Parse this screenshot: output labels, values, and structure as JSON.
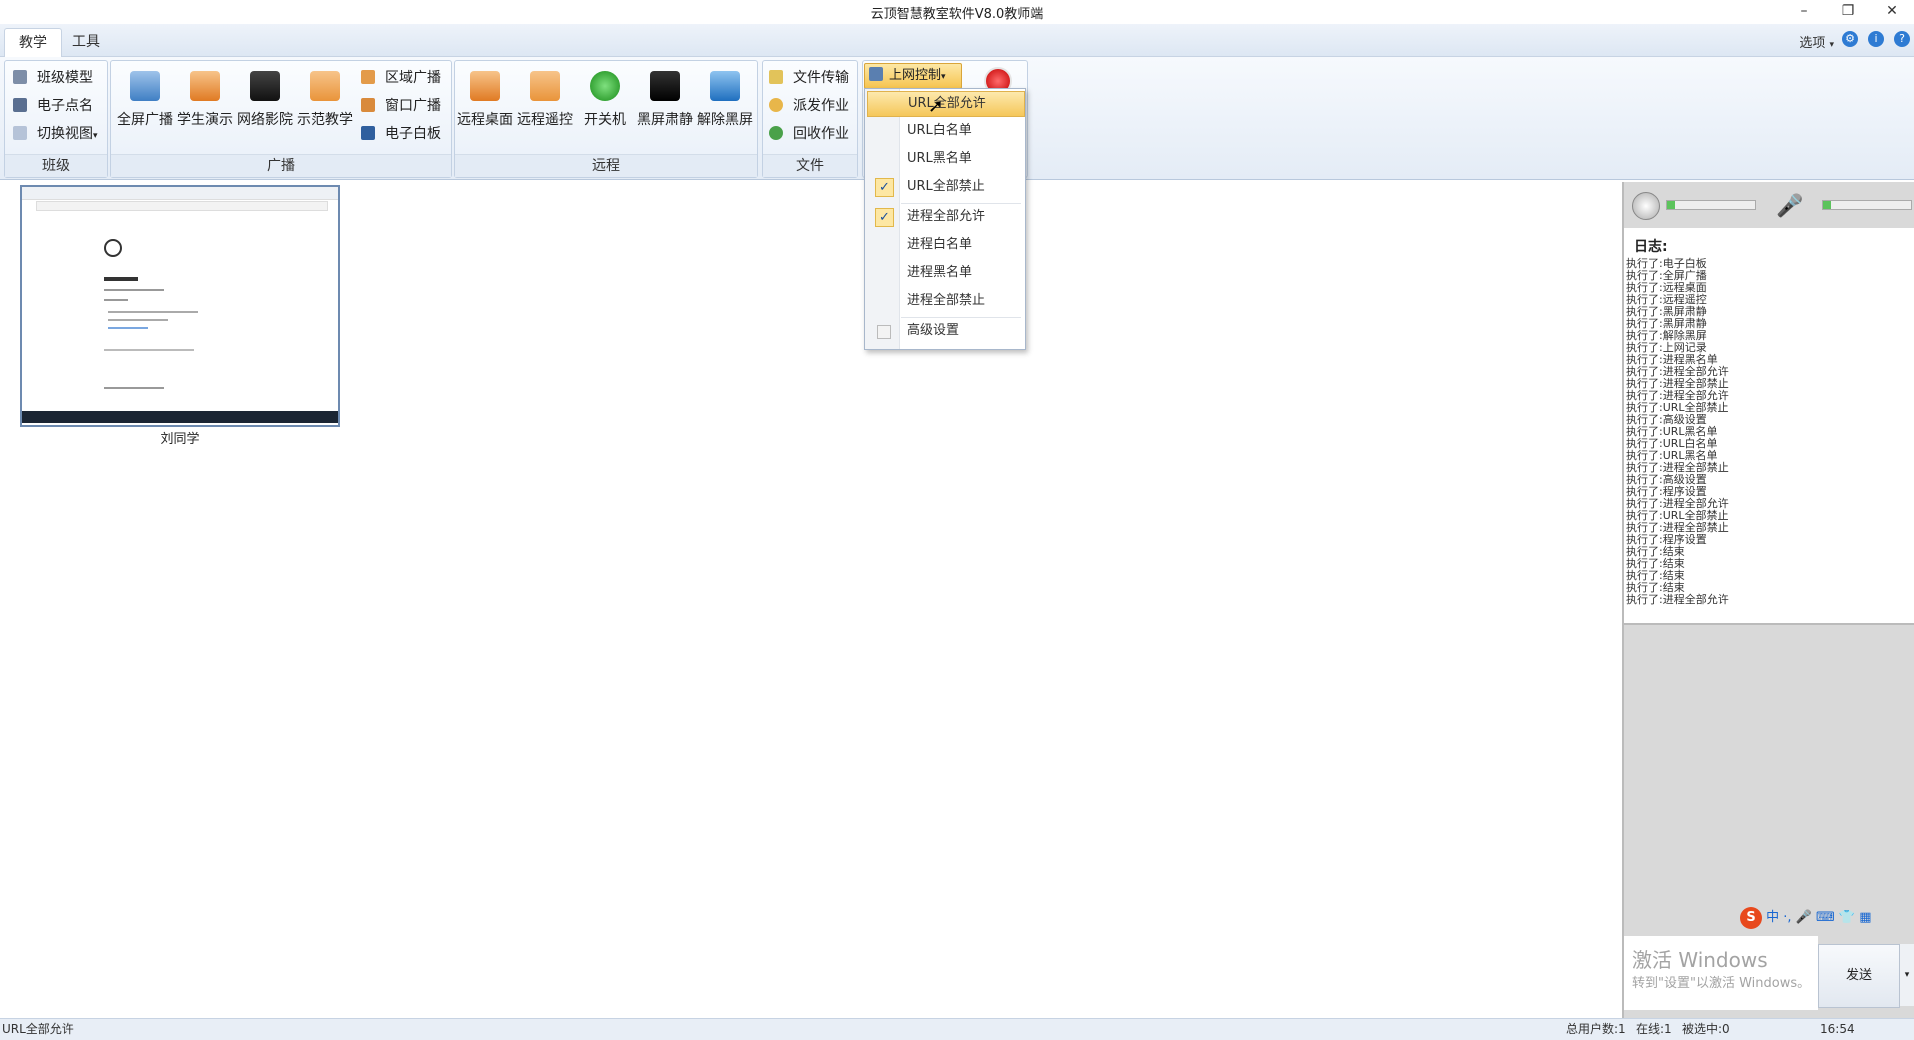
{
  "window": {
    "title": "云顶智慧教室软件V8.0教师端",
    "minimize": "–",
    "restore": "❐",
    "close": "✕"
  },
  "tabs": [
    {
      "label": "教学"
    },
    {
      "label": "工具"
    }
  ],
  "top_right": {
    "options_label": "选项"
  },
  "ribbon": {
    "class_group": {
      "caption": "班级",
      "items": [
        {
          "label": "班级模型"
        },
        {
          "label": "电子点名"
        },
        {
          "label": "切换视图"
        }
      ]
    },
    "broadcast_group": {
      "caption": "广播",
      "big_buttons": [
        {
          "label": "全屏广播"
        },
        {
          "label": "学生演示"
        },
        {
          "label": "网络影院"
        },
        {
          "label": "示范教学"
        }
      ],
      "small_items": [
        {
          "label": "区域广播"
        },
        {
          "label": "窗口广播"
        },
        {
          "label": "电子白板"
        }
      ]
    },
    "remote_group": {
      "caption": "远程",
      "big_buttons": [
        {
          "label": "远程桌面"
        },
        {
          "label": "远程遥控"
        },
        {
          "label": "开关机"
        },
        {
          "label": "黑屏肃静"
        },
        {
          "label": "解除黑屏"
        }
      ]
    },
    "file_group": {
      "caption": "文件",
      "items": [
        {
          "label": "文件传输"
        },
        {
          "label": "派发作业"
        },
        {
          "label": "回收作业"
        }
      ]
    },
    "network_control": {
      "label": "上网控制"
    }
  },
  "dropdown": {
    "items": [
      {
        "label": "URL全部允许",
        "checked": false,
        "highlighted": true
      },
      {
        "label": "URL白名单",
        "checked": false
      },
      {
        "label": "URL黑名单",
        "checked": false
      },
      {
        "label": "URL全部禁止",
        "checked": true
      },
      {
        "label": "进程全部允许",
        "checked": true
      },
      {
        "label": "进程白名单",
        "checked": false
      },
      {
        "label": "进程黑名单",
        "checked": false
      },
      {
        "label": "进程全部禁止",
        "checked": false
      },
      {
        "label": "高级设置",
        "checked": false
      }
    ]
  },
  "students": [
    {
      "name": "刘同学"
    }
  ],
  "log": {
    "title": "日志:",
    "lines": [
      "执行了:电子白板",
      "执行了:全屏广播",
      "执行了:远程桌面",
      "执行了:远程遥控",
      "执行了:黑屏肃静",
      "执行了:黑屏肃静",
      "执行了:解除黑屏",
      "执行了:上网记录",
      "执行了:进程黑名单",
      "执行了:进程全部允许",
      "执行了:进程全部禁止",
      "执行了:进程全部允许",
      "执行了:URL全部禁止",
      "执行了:高级设置",
      "执行了:URL黑名单",
      "执行了:URL白名单",
      "执行了:URL黑名单",
      "执行了:进程全部禁止",
      "执行了:高级设置",
      "执行了:程序设置",
      "执行了:进程全部允许",
      "执行了:URL全部禁止",
      "执行了:进程全部禁止",
      "执行了:程序设置",
      "执行了:结束",
      "执行了:结束",
      "执行了:结束",
      "执行了:结束",
      "执行了:进程全部允许"
    ]
  },
  "watermark": {
    "line1": "激活 Windows",
    "line2": "转到\"设置\"以激活 Windows。"
  },
  "send_button": {
    "label": "发送"
  },
  "status": {
    "left": "URL全部允许",
    "total_users": "总用户数:1",
    "online": "在线:1",
    "selected": "被选中:0",
    "time": "16:54"
  },
  "colors": {
    "accent": "#f2c14e",
    "ribbon_bg": "#e4ecf6",
    "panel_bg": "#d9d9d9"
  }
}
